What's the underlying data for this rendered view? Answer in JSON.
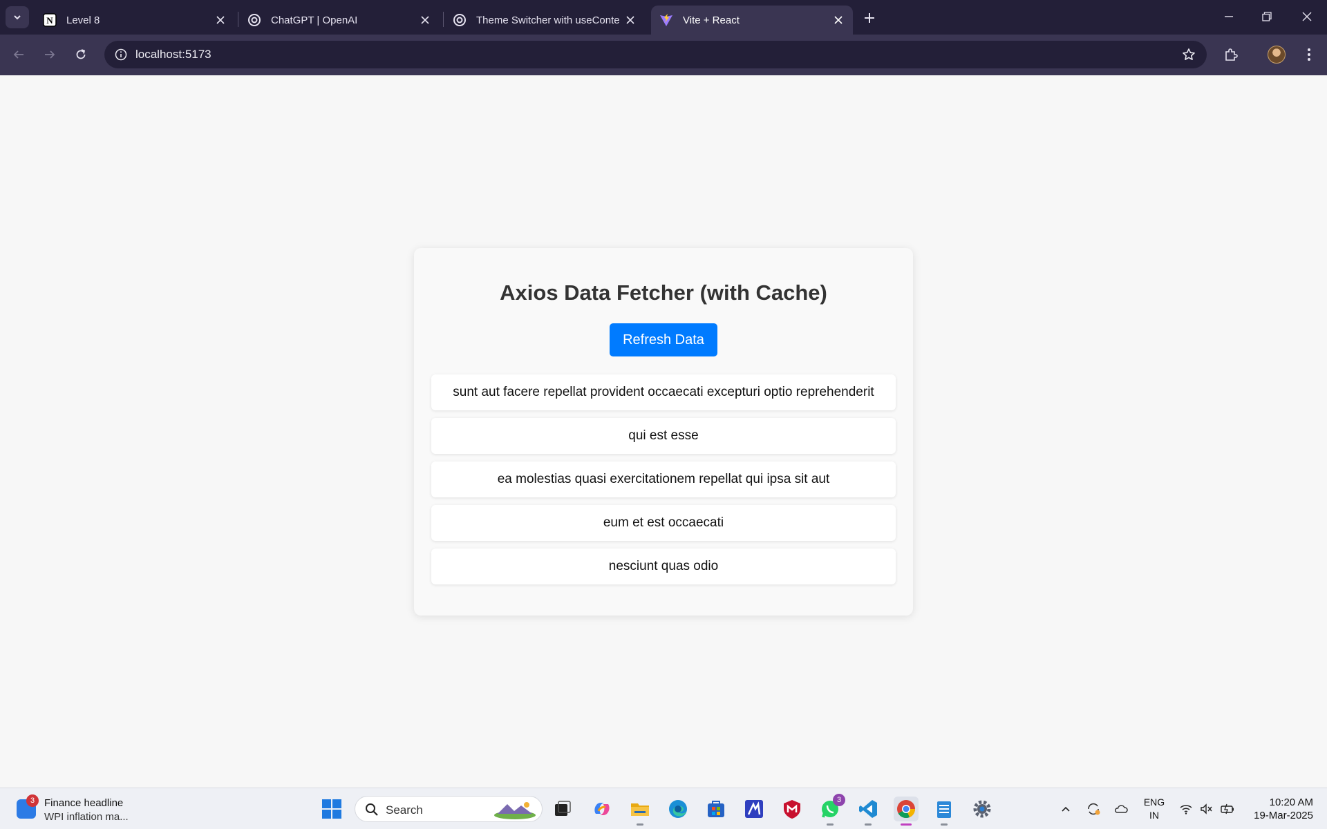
{
  "browser": {
    "tabs": [
      {
        "title": "Level 8",
        "icon": "notion-icon",
        "active": false
      },
      {
        "title": "ChatGPT | OpenAI",
        "icon": "openai-icon",
        "active": false
      },
      {
        "title": "Theme Switcher with useConte",
        "icon": "openai-icon",
        "active": false
      },
      {
        "title": "Vite + React",
        "icon": "vite-icon",
        "active": true
      }
    ],
    "url": "localhost:5173"
  },
  "app": {
    "title": "Axios Data Fetcher (with Cache)",
    "refresh_label": "Refresh Data",
    "accent_color": "#007bff",
    "posts": [
      "sunt aut facere repellat provident occaecati excepturi optio reprehenderit",
      "qui est esse",
      "ea molestias quasi exercitationem repellat qui ipsa sit aut",
      "eum et est occaecati",
      "nesciunt quas odio"
    ]
  },
  "taskbar": {
    "widget": {
      "title": "Finance headline",
      "subtitle": "WPI inflation ma...",
      "badge": "3"
    },
    "search_placeholder": "Search",
    "whatsapp_badge": "3",
    "language": {
      "line1": "ENG",
      "line2": "IN"
    },
    "time": "10:20 AM",
    "date": "19-Mar-2025"
  }
}
